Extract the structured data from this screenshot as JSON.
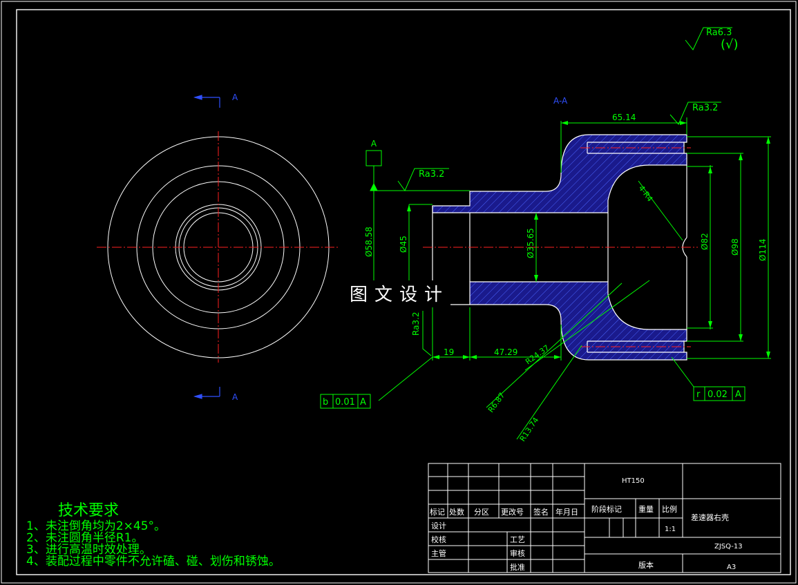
{
  "drawing": {
    "surface_finish_default": "Ra6.3",
    "surface_finish_other": "(√)",
    "section_label": "A",
    "section_title": "A-A",
    "datum_label": "A",
    "roughness_marks": [
      "Ra3.2",
      "Ra3.2",
      "Ra3.2"
    ],
    "dimensions": {
      "d58": "Ø58.58",
      "d45": "Ø45",
      "d35": "Ø35.65",
      "d82": "Ø82",
      "d98": "Ø98",
      "d114": "Ø114",
      "len1": "65.14",
      "len2": "19",
      "len3": "47.29",
      "r4": "4-R4",
      "r24": "R24.37",
      "r6": "R6.87",
      "r13": "R13.74"
    },
    "tolerance_frames": [
      {
        "symbol": "b",
        "value": "0.01",
        "datum": "A"
      },
      {
        "symbol": "r",
        "value": "0.02",
        "datum": "A"
      }
    ],
    "watermark": "图文设计"
  },
  "tech_requirements": {
    "title": "技术要求",
    "items": [
      "1、未注倒角均为2×45°。",
      "2、未注圆角半径R1。",
      "3、进行高温时效处理。",
      "4、装配过程中零件不允许磕、碰、划伤和锈蚀。"
    ]
  },
  "title_block": {
    "material": "HT150",
    "part_name": "差速器右壳",
    "drawing_number": "ZJSQ-13",
    "scale": "1:1",
    "sheet_size": "A3",
    "labels": {
      "mark": "标记",
      "count": "处数",
      "zone": "分区",
      "change_doc": "更改号",
      "sign": "签名",
      "date": "年月日",
      "design": "设计",
      "check": "校核",
      "supervisor": "主管",
      "process": "工艺",
      "review": "审核",
      "approve": "批准",
      "stage_mark": "阶段标记",
      "weight": "重量",
      "ratio": "比例",
      "version": "版本"
    }
  }
}
